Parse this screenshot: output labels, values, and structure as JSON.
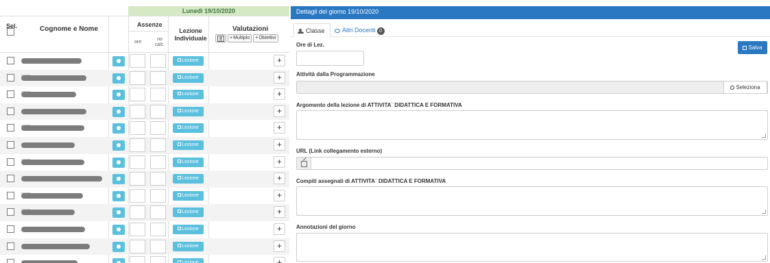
{
  "register": {
    "date_banner": "Lunedì 19/10/2020",
    "headers": {
      "sel": "Sel.",
      "name": "Cognome e Nome",
      "assenze": "Assenze",
      "ore": "ore",
      "no_calc": "no calc.",
      "lezione_individuale": "Lezione Individuale",
      "valutazioni": "Valutazioni",
      "multiplo": "Multiplo",
      "obiettivi": "Obiettivi"
    },
    "lesson_button_label": "Lezione",
    "add_label": "+",
    "rows": [
      {
        "prefix": "",
        "blur_width": 88
      },
      {
        "prefix": "[02] ...",
        "blur_width": 95
      },
      {
        "prefix": "[03]",
        "blur_width": 80
      },
      {
        "prefix": "",
        "blur_width": 95
      },
      {
        "prefix": "[05]",
        "blur_width": 92
      },
      {
        "prefix": "",
        "blur_width": 78
      },
      {
        "prefix": "[07]",
        "blur_width": 92
      },
      {
        "prefix": "",
        "blur_width": 118
      },
      {
        "prefix": "[09]",
        "blur_width": 90
      },
      {
        "prefix": "[10]",
        "blur_width": 78
      },
      {
        "prefix": "",
        "blur_width": 93
      },
      {
        "prefix": "",
        "blur_width": 100
      },
      {
        "prefix": "",
        "blur_width": 82
      }
    ]
  },
  "detail": {
    "title": "Dettagli del giorno 19/10/2020",
    "tabs": {
      "classe": "Classe",
      "altri_docenti": "Altri Docenti",
      "altri_docenti_count": "0"
    },
    "ore_lez_label": "Ore di Lez.",
    "ore_lez_value": "",
    "save_label": "Salva",
    "programmazione_label": "Attività dalla Programmazione",
    "seleziona_label": "Seleziona",
    "argomento_label": "Argomento della lezione di ATTIVITA` DIDATTICA E FORMATIVA",
    "argomento_value": "",
    "url_label": "URL (Link collegamento esterno)",
    "url_value": "",
    "compiti_label": "Compiti assegnati di ATTIVITA` DIDATTICA E FORMATIVA",
    "compiti_value": "",
    "annotazioni_label": "Annotazioni del giorno",
    "annotazioni_value": ""
  },
  "colors": {
    "date_banner_bg": "#d6e9c6",
    "panel_header_bg": "#2b78c2",
    "info_button_bg": "#5bc0de",
    "save_button_bg": "#2b78c2"
  }
}
